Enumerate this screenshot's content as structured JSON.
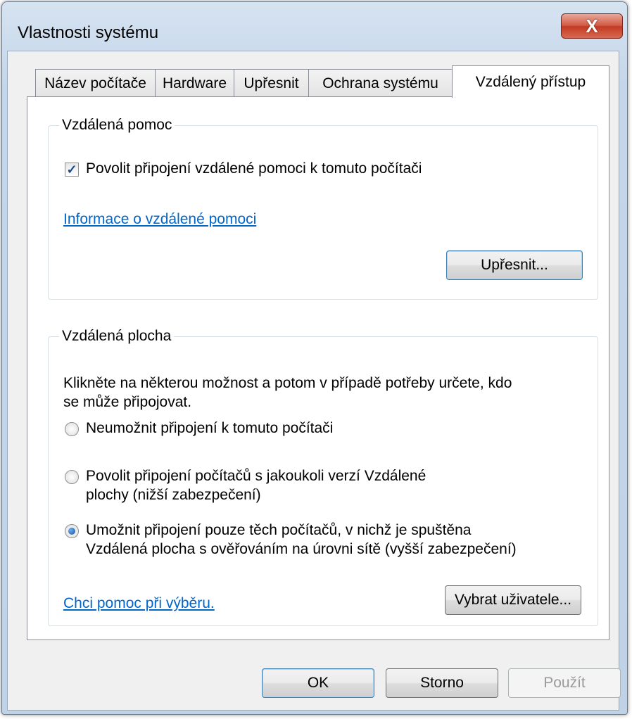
{
  "window": {
    "title": "Vlastnosti systému",
    "close_symbol": "X"
  },
  "tabs": [
    {
      "label": "Název počítače"
    },
    {
      "label": "Hardware"
    },
    {
      "label": "Upřesnit"
    },
    {
      "label": "Ochrana systému"
    },
    {
      "label": "Vzdálený přístup"
    }
  ],
  "remote_assistance": {
    "legend": "Vzdálená pomoc",
    "allow_label": "Povolit připojení vzdálené pomoci k tomuto počítači",
    "allow_checked": true,
    "info_link": "Informace o vzdálené pomoci",
    "advanced_button": "Upřesnit..."
  },
  "remote_desktop": {
    "legend": "Vzdálená plocha",
    "description_line1": "Klikněte na některou možnost a potom v případě potřeby určete, kdo",
    "description_line2": "se může připojovat.",
    "options": [
      {
        "line1": "Neumožnit připojení k tomuto počítači",
        "line2": "",
        "selected": false
      },
      {
        "line1": "Povolit připojení počítačů s jakoukoli verzí Vzdálené",
        "line2": "plochy (nižší zabezpečení)",
        "selected": false
      },
      {
        "line1": "Umožnit připojení pouze těch počítačů, v nichž je spuštěna",
        "line2": "Vzdálená plocha s ověřováním na úrovni sítě (vyšší zabezpečení)",
        "selected": true
      }
    ],
    "help_link": "Chci pomoc při výběru.",
    "select_users_button": "Vybrat uživatele..."
  },
  "footer": {
    "ok": "OK",
    "cancel": "Storno",
    "apply": "Použít"
  }
}
